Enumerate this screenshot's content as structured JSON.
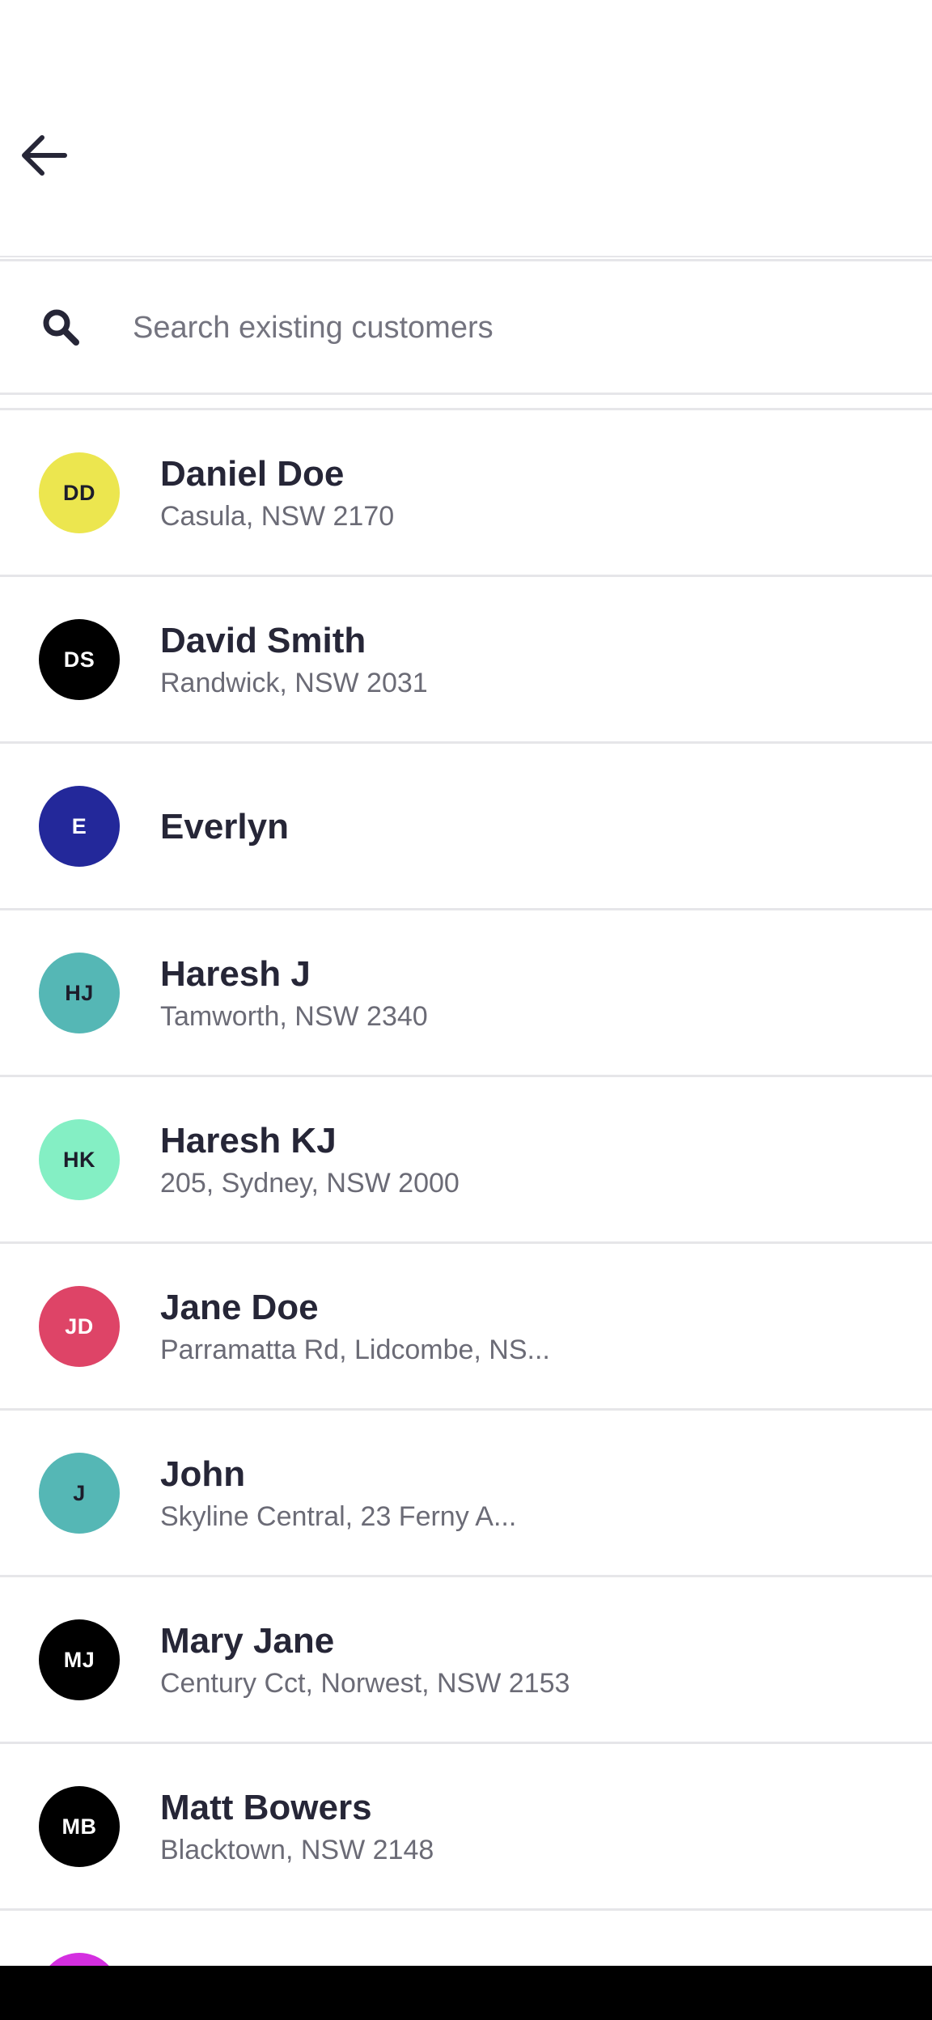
{
  "header": {
    "back_icon": "arrow-left-icon"
  },
  "search": {
    "icon": "search-icon",
    "value": "",
    "placeholder": "Search existing customers"
  },
  "customers": [
    {
      "initials": "DD",
      "name": "Daniel Doe",
      "address": "Casula, NSW 2170",
      "avatar_bg": "#ece64f",
      "avatar_fg": "#1d1d2b"
    },
    {
      "initials": "DS",
      "name": "David Smith",
      "address": "Randwick, NSW 2031",
      "avatar_bg": "#000000",
      "avatar_fg": "#ffffff"
    },
    {
      "initials": "E",
      "name": "Everlyn",
      "address": "",
      "avatar_bg": "#23289a",
      "avatar_fg": "#ffffff"
    },
    {
      "initials": "HJ",
      "name": "Haresh J",
      "address": "Tamworth, NSW 2340",
      "avatar_bg": "#55b7b5",
      "avatar_fg": "#1d1d2b"
    },
    {
      "initials": "HK",
      "name": "Haresh KJ",
      "address": "205, Sydney, NSW 2000",
      "avatar_bg": "#84efc4",
      "avatar_fg": "#1d1d2b"
    },
    {
      "initials": "JD",
      "name": "Jane Doe",
      "address": "Parramatta Rd, Lidcombe, NS...",
      "avatar_bg": "#de4467",
      "avatar_fg": "#ffffff"
    },
    {
      "initials": "J",
      "name": "John",
      "address": "Skyline Central, 23 Ferny A...",
      "avatar_bg": "#55b7b5",
      "avatar_fg": "#1d1d2b"
    },
    {
      "initials": "MJ",
      "name": "Mary Jane",
      "address": "Century Cct, Norwest, NSW 2153",
      "avatar_bg": "#000000",
      "avatar_fg": "#ffffff"
    },
    {
      "initials": "MB",
      "name": "Matt Bowers",
      "address": "Blacktown, NSW 2148",
      "avatar_bg": "#000000",
      "avatar_fg": "#ffffff"
    },
    {
      "initials": "",
      "name": "",
      "address": "",
      "avatar_bg": "#d42fe0",
      "avatar_fg": "#ffffff"
    }
  ]
}
